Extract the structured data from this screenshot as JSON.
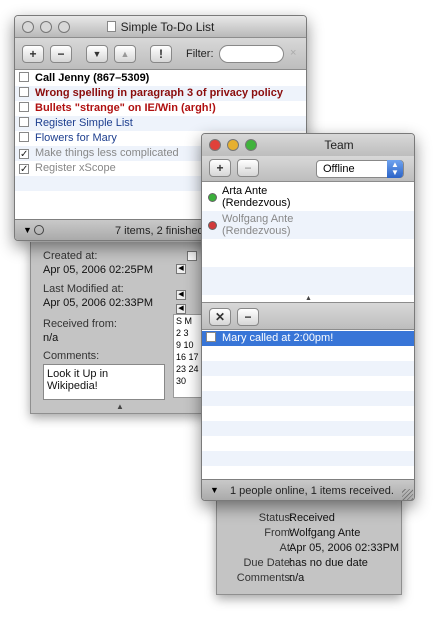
{
  "todo": {
    "title": "Simple To-Do List",
    "filter_label": "Filter:",
    "items": [
      {
        "text": "Call Jenny (867–5309)",
        "style": "bold",
        "checked": false
      },
      {
        "text": "Wrong spelling in paragraph 3 of privacy policy",
        "style": "red",
        "checked": false
      },
      {
        "text": "Bullets \"strange\" on IE/Win (argh!)",
        "style": "red",
        "checked": false
      },
      {
        "text": "Register Simple List",
        "style": "blue",
        "checked": false
      },
      {
        "text": "Flowers for Mary",
        "style": "blue",
        "checked": false
      },
      {
        "text": "Make things less complicated",
        "style": "done",
        "checked": true
      },
      {
        "text": "Register xScope",
        "style": "done",
        "checked": true
      }
    ],
    "status": "7 items, 2 finished"
  },
  "details": {
    "created_label": "Created at:",
    "created_value": "Apr 05, 2006 02:25PM",
    "modified_label": "Last Modified at:",
    "modified_value": "Apr 05, 2006 02:33PM",
    "received_label": "Received from:",
    "received_value": "n/a",
    "comments_label": "Comments:",
    "comments_value": "Look it Up in Wikipedia!",
    "calendar": {
      "header": "S M",
      "rows": [
        "",
        "2  3",
        "9  10",
        "16 17",
        "23 24",
        "30"
      ]
    }
  },
  "team": {
    "title": "Team",
    "status_select": "Offline",
    "people": [
      {
        "name": "Arta Ante",
        "sub": "(Rendezvous)",
        "status": "online",
        "color": "#3ab03a"
      },
      {
        "name": "Wolfgang Ante",
        "sub": "(Rendezvous)",
        "status": "offline",
        "color": "#d23a3a"
      }
    ],
    "messages": [
      {
        "text": "Mary called at 2:00pm!",
        "selected": true,
        "checked": false
      }
    ],
    "status": "1 people online, 1 items received."
  },
  "message_detail": {
    "status_label": "Status:",
    "status_value": "Received",
    "from_label": "From:",
    "from_value": "Wolfgang Ante",
    "at_label": "At:",
    "at_value": "Apr 05, 2006 02:33PM",
    "due_label": "Due Date:",
    "due_value": "has no due date",
    "comments_label": "Comments:",
    "comments_value": "n/a"
  }
}
